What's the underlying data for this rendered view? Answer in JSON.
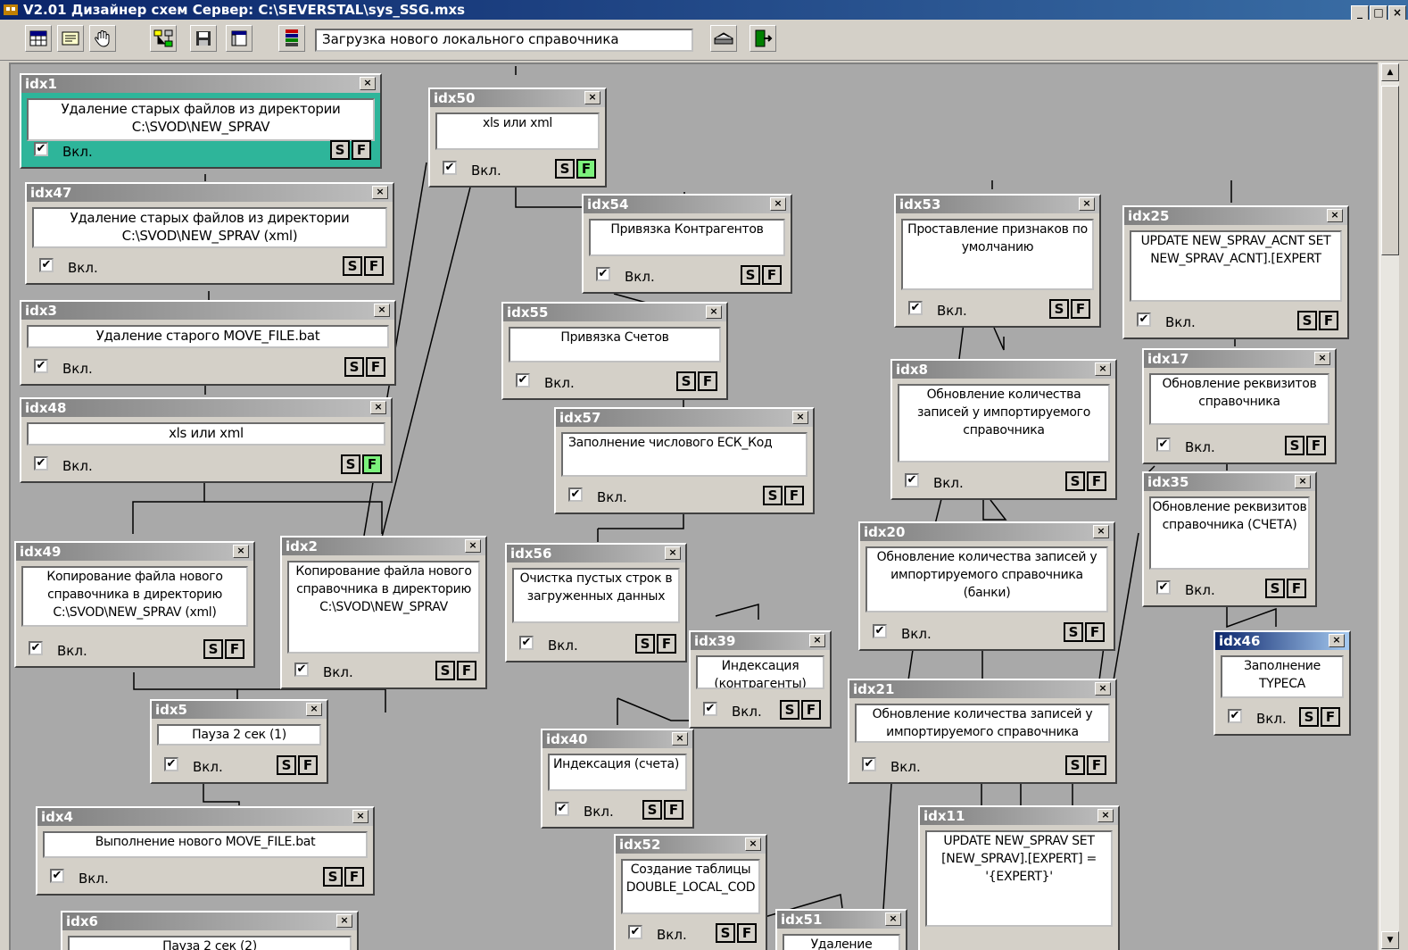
{
  "window": {
    "title": "V2.01 Дизайнер схем Сервер: C:\\SEVERSTAL\\sys_SSG.mxs",
    "controls": [
      "_",
      "□",
      "×"
    ]
  },
  "toolbar": {
    "current_step": "Загрузка нового локального справочника",
    "icons": [
      "table-icon",
      "list-icon",
      "hand-icon",
      "network-icon",
      "save-icon",
      "window-icon",
      "bars-icon",
      "printer-icon",
      "exit-icon"
    ]
  },
  "node_common": {
    "enabled_label": "Вкл.",
    "s_label": "S",
    "f_label": "F",
    "checkmark": "✔",
    "close": "×"
  },
  "nodes": [
    {
      "id": "idx1",
      "text": "Удаление старых файлов из директории C:\\SVOD\\NEW_SPRAV",
      "enabled": true,
      "f_active": false,
      "selected": true
    },
    {
      "id": "idx47",
      "text": "Удаление старых файлов из директории C:\\SVOD\\NEW_SPRAV (xml)",
      "enabled": true,
      "f_active": false
    },
    {
      "id": "idx3",
      "text": "Удаление старого MOVE_FILE.bat",
      "enabled": true,
      "f_active": false
    },
    {
      "id": "idx48",
      "text": "xls или xml",
      "enabled": true,
      "f_active": true
    },
    {
      "id": "idx49",
      "text": "Копирование файла нового справочника в директорию C:\\SVOD\\NEW_SPRAV (xml)",
      "enabled": true,
      "f_active": false
    },
    {
      "id": "idx2",
      "text": "Копирование файла нового справочника в директорию C:\\SVOD\\NEW_SPRAV",
      "enabled": true,
      "f_active": false
    },
    {
      "id": "idx5",
      "text": "Пауза 2 сек (1)",
      "enabled": true,
      "f_active": false
    },
    {
      "id": "idx4",
      "text": "Выполнение нового MOVE_FILE.bat",
      "enabled": true,
      "f_active": false
    },
    {
      "id": "idx6",
      "text": "Пауза 2 сек (2)",
      "enabled": true,
      "f_active": false
    },
    {
      "id": "idx50",
      "text": "xls или xml",
      "enabled": true,
      "f_active": true
    },
    {
      "id": "idx54",
      "text": "Привязка Контрагентов",
      "enabled": true,
      "f_active": false
    },
    {
      "id": "idx55",
      "text": "Привязка Счетов",
      "enabled": true,
      "f_active": false
    },
    {
      "id": "idx57",
      "text": "Заполнение числового ЕСК_Код",
      "enabled": true,
      "f_active": false
    },
    {
      "id": "idx56",
      "text": "Очистка пустых строк в загруженных данных",
      "enabled": true,
      "f_active": false
    },
    {
      "id": "idx39",
      "text": "Индексация (контрагенты)",
      "enabled": true,
      "f_active": false
    },
    {
      "id": "idx40",
      "text": "Индексация (счета)",
      "enabled": true,
      "f_active": false
    },
    {
      "id": "idx52",
      "text": "Создание таблицы DOUBLE_LOCAL_COD",
      "enabled": true,
      "f_active": false
    },
    {
      "id": "idx51",
      "text": "Удаление",
      "enabled": true,
      "f_active": false
    },
    {
      "id": "idx53",
      "text": "Проставление признаков по умолчанию",
      "enabled": true,
      "f_active": false
    },
    {
      "id": "idx8",
      "text": "Обновление количества записей у импортируемого справочника",
      "enabled": true,
      "f_active": false
    },
    {
      "id": "idx20",
      "text": "Обновление количества записей у импортируемого справочника (банки)",
      "enabled": true,
      "f_active": false
    },
    {
      "id": "idx21",
      "text": "Обновление количества записей у импортируемого справочника",
      "enabled": true,
      "f_active": false
    },
    {
      "id": "idx11",
      "text": "UPDATE NEW_SPRAV SET [NEW_SPRAV].[EXPERT] = '{EXPERT}'",
      "enabled": true,
      "f_active": false
    },
    {
      "id": "idx25",
      "text": "UPDATE NEW_SPRAV_ACNT SET NEW_SPRAV_ACNT].[EXPERT",
      "enabled": true,
      "f_active": false
    },
    {
      "id": "idx17",
      "text": "Обновление реквизитов справочника",
      "enabled": true,
      "f_active": false
    },
    {
      "id": "idx35",
      "text": "Обновление реквизитов справочника (СЧЕТА)",
      "enabled": true,
      "f_active": false
    },
    {
      "id": "idx46",
      "text": "Заполнение TYPECA",
      "enabled": true,
      "f_active": false,
      "active": true
    }
  ]
}
